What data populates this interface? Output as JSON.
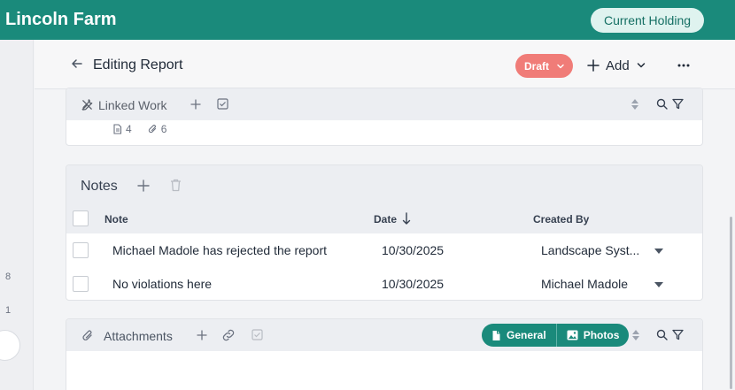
{
  "header": {
    "title": "Lincoln Farm",
    "current_holding_label": "Current Holding"
  },
  "left_rail": {
    "numbers": [
      "8",
      "1"
    ]
  },
  "subheader": {
    "title": "Editing Report",
    "status": "Draft",
    "add_label": "Add"
  },
  "linked_work": {
    "title": "Linked Work",
    "document_count": "4",
    "attachment_count": "6"
  },
  "notes": {
    "title": "Notes",
    "columns": {
      "note": "Note",
      "date": "Date",
      "created_by": "Created By"
    },
    "rows": [
      {
        "note": "Michael Madole has rejected the report",
        "date": "10/30/2025",
        "created_by": "Landscape Syst..."
      },
      {
        "note": "No violations here",
        "date": "10/30/2025",
        "created_by": "Michael Madole"
      }
    ]
  },
  "attachments": {
    "title": "Attachments",
    "tabs": [
      "General",
      "Photos"
    ]
  },
  "colors": {
    "brand": "#1a8a7b",
    "draft": "#f07c78",
    "holding_bg": "#dff3ef"
  },
  "icons": [
    "back-arrow-icon",
    "chevron-down-icon",
    "plus-icon",
    "more-icon",
    "tools-icon",
    "checkbox-icon",
    "sort-icon",
    "search-icon",
    "filter-icon",
    "document-icon",
    "paperclip-icon",
    "trash-icon",
    "link-icon",
    "image-icon",
    "arrow-down-icon"
  ]
}
